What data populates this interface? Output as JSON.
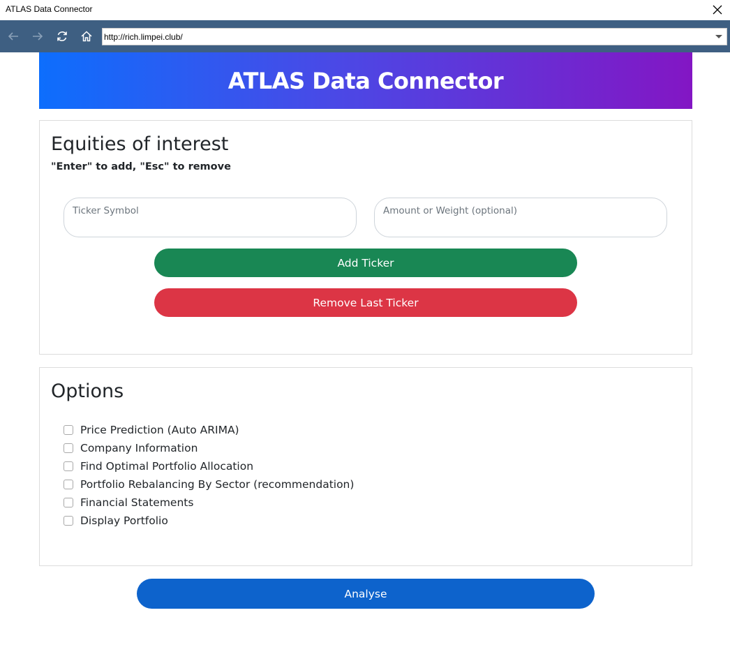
{
  "window": {
    "title": "ATLAS Data Connector"
  },
  "browser": {
    "url": "http://rich.limpei.club/"
  },
  "header": {
    "title": "ATLAS Data Connector"
  },
  "equities": {
    "heading": "Equities of interest",
    "hint": "\"Enter\" to add, \"Esc\" to remove",
    "ticker_placeholder": "Ticker Symbol",
    "amount_placeholder": "Amount or Weight (optional)",
    "add_label": "Add Ticker",
    "remove_label": "Remove Last Ticker"
  },
  "options": {
    "heading": "Options",
    "items": [
      {
        "label": "Price Prediction (Auto ARIMA)",
        "checked": false
      },
      {
        "label": "Company Information",
        "checked": false
      },
      {
        "label": "Find Optimal Portfolio Allocation",
        "checked": false
      },
      {
        "label": "Portfolio Rebalancing By Sector (recommendation)",
        "checked": false
      },
      {
        "label": "Financial Statements",
        "checked": false
      },
      {
        "label": "Display Portfolio",
        "checked": false
      }
    ]
  },
  "actions": {
    "analyse_label": "Analyse"
  },
  "colors": {
    "nav_bar": "#3e5f82",
    "header_gradient_start": "#0d6efd",
    "header_gradient_end": "#8316c4",
    "add_button": "#198754",
    "remove_button": "#dc3545",
    "analyse_button": "#0d63cc"
  }
}
